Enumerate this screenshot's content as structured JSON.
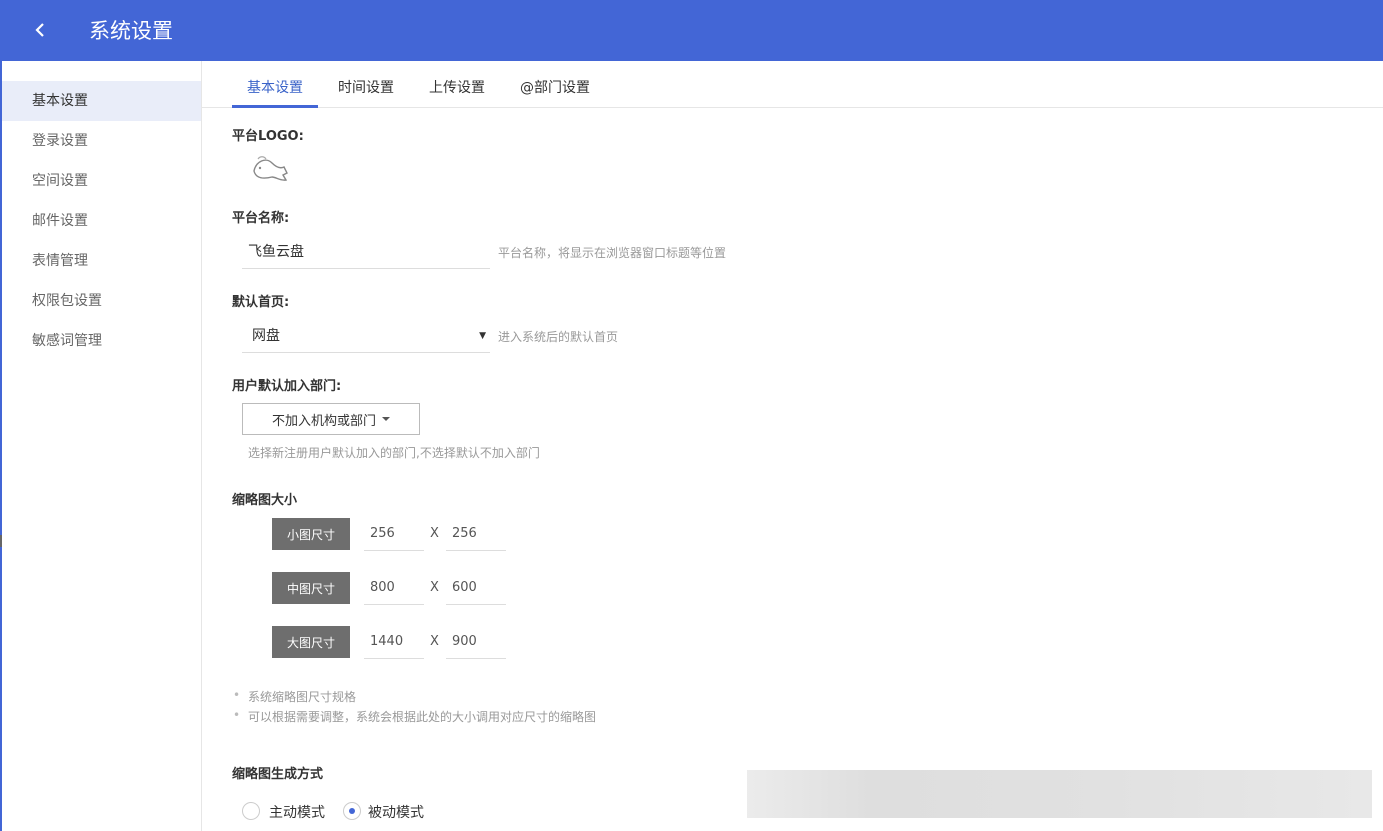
{
  "header": {
    "title": "系统设置"
  },
  "sidebar": {
    "items": [
      {
        "label": "基本设置"
      },
      {
        "label": "登录设置"
      },
      {
        "label": "空间设置"
      },
      {
        "label": "邮件设置"
      },
      {
        "label": "表情管理"
      },
      {
        "label": "权限包设置"
      },
      {
        "label": "敏感词管理"
      }
    ]
  },
  "tabs": [
    {
      "label": "基本设置"
    },
    {
      "label": "时间设置"
    },
    {
      "label": "上传设置"
    },
    {
      "label": "@部门设置"
    }
  ],
  "form": {
    "logo_label": "平台LOGO:",
    "name_label": "平台名称:",
    "name_value": "飞鱼云盘",
    "name_hint": "平台名称，将显示在浏览器窗口标题等位置",
    "home_label": "默认首页:",
    "home_value": "网盘",
    "home_hint": "进入系统后的默认首页",
    "dept_label": "用户默认加入部门:",
    "dept_button": "不加入机构或部门",
    "dept_hint": "选择新注册用户默认加入的部门,不选择默认不加入部门",
    "thumb_label": "缩略图大小",
    "thumb_sizes": [
      {
        "button": "小图尺寸",
        "width": "256",
        "height": "256"
      },
      {
        "button": "中图尺寸",
        "width": "800",
        "height": "600"
      },
      {
        "button": "大图尺寸",
        "width": "1440",
        "height": "900"
      }
    ],
    "x_sep": "X",
    "notes": [
      "系统缩略图尺寸规格",
      "可以根据需要调整，系统会根据此处的大小调用对应尺寸的缩略图"
    ],
    "gen_label": "缩略图生成方式",
    "gen_options": [
      {
        "label": "主动模式",
        "checked": false
      },
      {
        "label": "被动模式",
        "checked": true
      }
    ]
  },
  "colors": {
    "primary": "#4366d6",
    "size_button": "#6e6e6e"
  }
}
